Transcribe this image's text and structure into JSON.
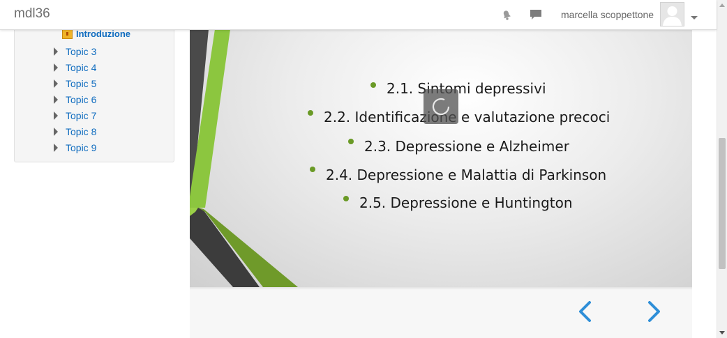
{
  "navbar": {
    "brand": "mdl36",
    "notifications_icon": "bell-icon",
    "messages_icon": "speech-bubble-icon",
    "username": "marcella scoppettone",
    "avatar_icon": "user-avatar-icon",
    "menu_icon": "caret-down-icon"
  },
  "sidebar": {
    "current_section": {
      "label": "Introduzione",
      "icon": "locked-section-icon"
    },
    "topics": [
      {
        "label": "Topic 3"
      },
      {
        "label": "Topic 4"
      },
      {
        "label": "Topic 5"
      },
      {
        "label": "Topic 6"
      },
      {
        "label": "Topic 7"
      },
      {
        "label": "Topic 8"
      },
      {
        "label": "Topic 9"
      }
    ]
  },
  "slide": {
    "bullets": [
      "2.1. Sintomi depressivi",
      "2.2. Identificazione e valutazione precoci",
      "2.3. Depressione e Alzheimer",
      "2.4. Depressione e Malattia di Parkinson",
      "2.5. Depressione e Huntington"
    ],
    "loading_icon": "loading-spinner-icon",
    "prev_icon": "chevron-left-icon",
    "next_icon": "chevron-right-icon"
  },
  "colors": {
    "link": "#0f6cbf",
    "bullet_green": "#6a9a26",
    "accent_green": "#8cc63f",
    "nav_arrow": "#2f8fd8"
  }
}
